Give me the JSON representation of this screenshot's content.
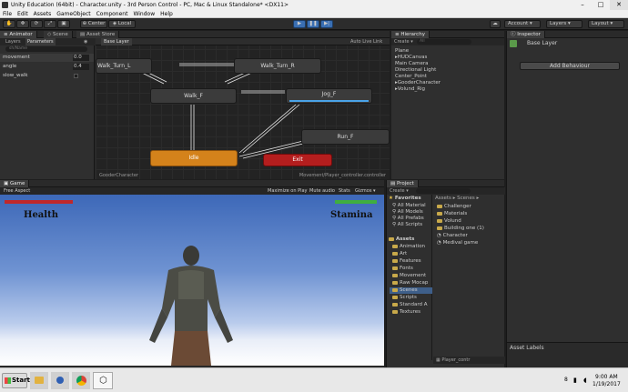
{
  "window": {
    "title": "Unity Education (64bit) - Character.unity - 3rd Person Control - PC, Mac & Linux Standalone* <DX11>",
    "controls": [
      "–",
      "□",
      "✕"
    ]
  },
  "menu": [
    "File",
    "Edit",
    "Assets",
    "GameObject",
    "Component",
    "Window",
    "Help"
  ],
  "toolbar": {
    "pivot_label": "Center",
    "local_label": "Local",
    "account_label": "Account",
    "layers_label": "Layers",
    "layout_label": "Layout"
  },
  "animator": {
    "tabs": [
      "Animator",
      "Scene",
      "Asset Store"
    ],
    "subtabs": [
      "Layers",
      "Parameters"
    ],
    "breadcrumb": "Base Layer",
    "auto_live_link": "Auto Live Link",
    "search_placeholder": "sh/Name",
    "params": [
      {
        "name": "movement",
        "value": "0.0"
      },
      {
        "name": "angle",
        "value": "0.4"
      },
      {
        "name": "slow_walk",
        "value": ""
      }
    ],
    "nodes": {
      "walk_turn_l": "Walk_Turn_L",
      "walk_turn_r": "Walk_Turn_R",
      "walk_f": "Walk_F",
      "jog_f": "Jog_F",
      "run_f": "Run_F",
      "idle": "Idle",
      "exit": "Exit"
    },
    "footer_left": "GooderCharacter",
    "footer_right": "Movement/Player_controller.controller"
  },
  "hierarchy": {
    "tab": "Hierarchy",
    "create_label": "Create ▾",
    "search_placeholder": "All",
    "items": [
      "Plane",
      "HUDCanvas",
      "Main Camera",
      "Directional Light",
      "Center_Point",
      "GooderCharacter",
      "Volund_Rig"
    ]
  },
  "inspector": {
    "tab": "Inspector",
    "layer_name": "Base Layer",
    "add_behaviour": "Add Behaviour"
  },
  "game": {
    "tab": "Game",
    "aspect": "Free Aspect",
    "options": [
      "Maximize on Play",
      "Mute audio",
      "Stats",
      "Gizmos ▾"
    ],
    "health_label": "Health",
    "stamina_label": "Stamina",
    "health_color": "#c0282b",
    "stamina_color": "#3fae3f"
  },
  "project": {
    "tab": "Project",
    "create_label": "Create ▾",
    "favorites_label": "Favorites",
    "favorites": [
      "All Material",
      "All Models",
      "All Prefabs",
      "All Scripts"
    ],
    "assets_label": "Assets",
    "asset_folders": [
      "Animation",
      "Art",
      "Features",
      "Fonts",
      "Movement",
      "Raw Mocap",
      "Scenes",
      "Scripts",
      "Standard A",
      "Textures"
    ],
    "breadcrumb": "Assets ▸ Scenes ▸",
    "files": [
      "Challenger",
      "Materials",
      "Volund",
      "Building one (1)",
      "Character",
      "Medival game"
    ],
    "footer": "Player_contr"
  },
  "asset_labels": "Asset Labels",
  "taskbar": {
    "start_label": "Start",
    "time": "9:00 AM",
    "date": "1/19/2017",
    "tray_num": "8"
  }
}
